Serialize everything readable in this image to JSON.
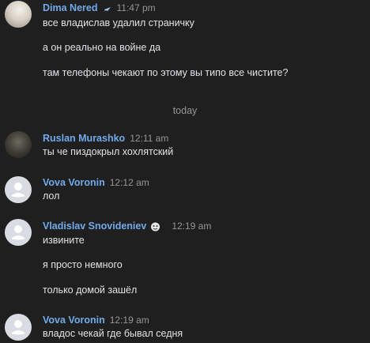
{
  "messages": [
    {
      "author": "Dima Nered",
      "time": "11:47 pm",
      "lines": [
        "все владислав удалил страничку",
        "а он реально на войне да",
        "там телефоны чекают по этому вы типо все чистите?"
      ]
    },
    {
      "author": "Ruslan Murashko",
      "time": "12:11 am",
      "lines": [
        "ты че пиздокрыл хохлятский"
      ]
    },
    {
      "author": "Vova Voronin",
      "time": "12:12 am",
      "lines": [
        "лол"
      ]
    },
    {
      "author": "Vladislav Snovideniev",
      "time": "12:19 am",
      "lines": [
        "извините",
        "я просто немного",
        "только домой зашёл"
      ]
    },
    {
      "author": "Vova Voronin",
      "time": "12:19 am",
      "lines": [
        "владос чекай где бывал седня"
      ]
    }
  ],
  "divider": "today",
  "colors": {
    "background": "#1f1f1f",
    "author_name": "#71aaeb",
    "timestamp": "#939699",
    "message_text": "#e1e3e6"
  },
  "icons": {
    "dima_badge": "rocket-icon",
    "vladislav_badge": "emoji-status-icon"
  }
}
